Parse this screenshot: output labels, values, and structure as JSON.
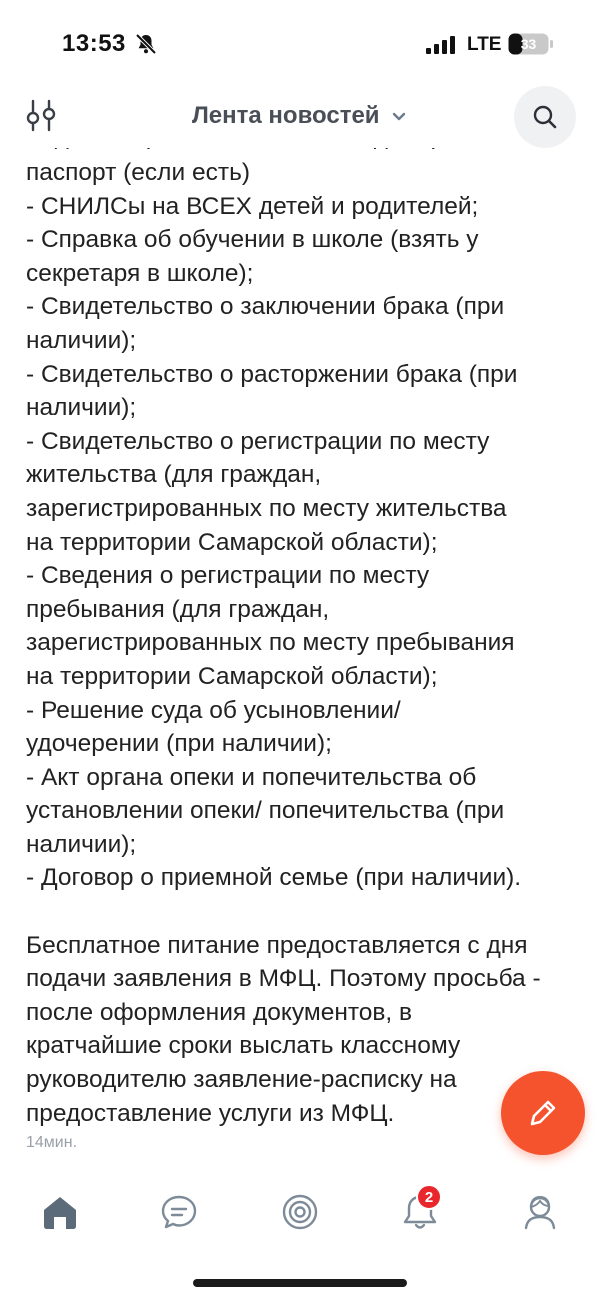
{
  "status_bar": {
    "time": "13:53",
    "network": "LTE",
    "battery_level": "33"
  },
  "header": {
    "title": "Лента новостей"
  },
  "post": {
    "cut_line": "- Удостоверение личности каждого ребенка",
    "lines": [
      "паспорт (если есть)",
      "- СНИЛСы на ВСЕХ детей и родителей;",
      "- Справка об обучении в  школе (взять у",
      "секретаря в школе);",
      "- Свидетельство о заключении брака (при",
      "наличии);",
      "- Свидетельство о расторжении брака (при",
      "наличии);",
      "- Свидетельство о регистрации по месту",
      "жительства (для граждан,",
      "зарегистрированных по месту жительства",
      "на территории Самарской области);",
      "- Сведения о регистрации по месту",
      "пребывания (для граждан,",
      "зарегистрированных по месту пребывания",
      "на территории Самарской области);",
      "- Решение суда об усыновлении/",
      "удочерении (при наличии);",
      "- Акт органа опеки и попечительства об",
      "установлении опеки/ попечительства (при",
      "наличии);",
      "- Договор о приемной семье (при наличии)."
    ],
    "paragraph2": [
      "Бесплатное питание предоставляется с дня",
      "подачи заявления в МФЦ. Поэтому просьба -",
      "после оформления документов, в",
      "кратчайшие сроки выслать классному",
      "руководителю заявление-расписку на",
      "предоставление услуги из МФЦ."
    ],
    "time_ago": "14мин."
  },
  "nav": {
    "notifications_badge": "2"
  },
  "colors": {
    "accent": "#f5532d",
    "badge": "#e8262b",
    "home_active": "#5c6b7a"
  }
}
